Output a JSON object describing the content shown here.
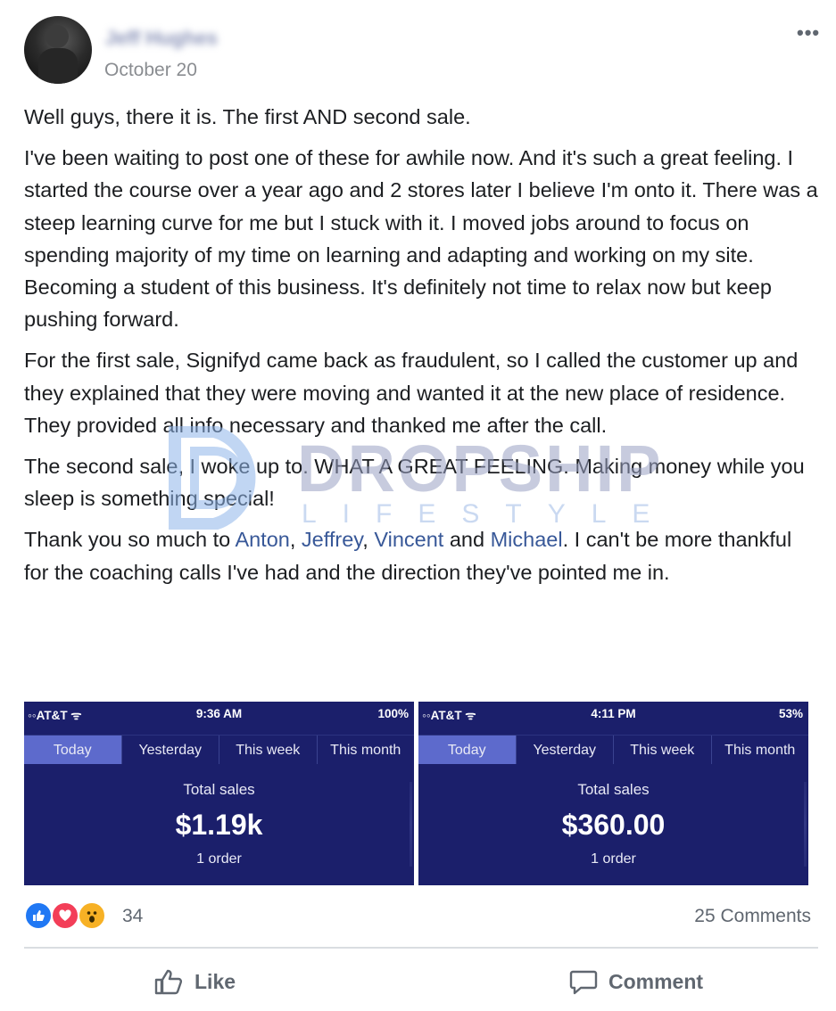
{
  "post": {
    "author_name": "Jeff Hughes",
    "date": "October 20",
    "more_menu": "•••",
    "paragraphs": {
      "p1": "Well guys, there it is. The first AND second sale.",
      "p2": "I've been waiting to post one of these for awhile now. And it's such a great feeling. I started the course over a year ago and 2 stores later I believe I'm onto it. There was a steep learning curve for me but I stuck with it. I moved jobs around to focus on spending majority of my time on learning and adapting and working on my site. Becoming a student of this business. It's definitely not time to relax now but keep pushing forward.",
      "p3": "For the first sale, Signifyd came back as fraudulent, so I called the customer up and they explained that they were moving and wanted it at the new place of residence. They provided all info necessary and thanked me after the call.",
      "p4": "The second sale, I woke up to. WHAT A GREAT FEELING. Making money while you sleep is something special!",
      "p5_start": "Thank you so much to ",
      "p5_sep1": ", ",
      "p5_sep2": ", ",
      "p5_sep3": " and ",
      "p5_end": ". I can't be more thankful for the coaching calls I've had and the direction they've pointed me in."
    },
    "mentions": [
      "Anton",
      "Jeffrey",
      "Vincent",
      "Michael"
    ]
  },
  "watermark": {
    "title": "DROPSHIP",
    "subtitle": "LIFESTYLE"
  },
  "screenshots": [
    {
      "carrier": "◦◦AT&T ᯤ",
      "time": "9:36 AM",
      "battery": "100%",
      "tabs": [
        "Today",
        "Yesterday",
        "This week",
        "This month"
      ],
      "active_tab": "Today",
      "total_label": "Total sales",
      "total_value": "$1.19k",
      "orders": "1 order"
    },
    {
      "carrier": "◦◦AT&T ᯤ",
      "time": "4:11 PM",
      "battery": "53%",
      "tabs": [
        "Today",
        "Yesterday",
        "This week",
        "This month"
      ],
      "active_tab": "Today",
      "total_label": "Total sales",
      "total_value": "$360.00",
      "orders": "1 order"
    }
  ],
  "engagement": {
    "reaction_icons": [
      "like-icon",
      "love-icon",
      "wow-icon"
    ],
    "reaction_count": "34",
    "comments": "25 Comments"
  },
  "actions": {
    "like_label": "Like",
    "comment_label": "Comment"
  },
  "colors": {
    "mention": "#385898",
    "screenshot_bg": "#1b1f6b",
    "active_tab": "#5d6acc",
    "like_blue": "#2078f4",
    "love_red": "#f33e58",
    "wow_yellow": "#f7b125"
  }
}
